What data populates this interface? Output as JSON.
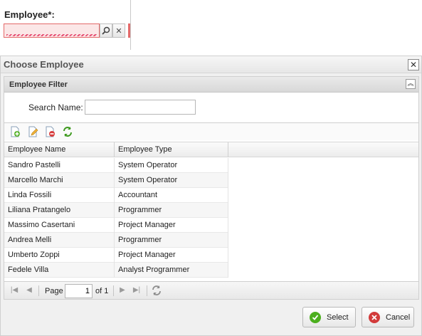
{
  "form": {
    "employee_label": "Employee*:",
    "employee_value": ""
  },
  "dialog": {
    "title": "Choose Employee",
    "filter": {
      "title": "Employee Filter",
      "search_label": "Search Name:",
      "search_value": ""
    },
    "toolbar": {
      "icons": [
        "add-record-icon",
        "edit-record-icon",
        "delete-record-icon",
        "refresh-icon"
      ]
    },
    "grid": {
      "columns": [
        "Employee Name",
        "Employee Type"
      ],
      "rows": [
        [
          "Sandro Pastelli",
          "System Operator"
        ],
        [
          "Marcello Marchi",
          "System Operator"
        ],
        [
          "Linda Fossili",
          "Accountant"
        ],
        [
          "Liliana Pratangelo",
          "Programmer"
        ],
        [
          "Massimo Casertani",
          "Project Manager"
        ],
        [
          "Andrea Melli",
          "Programmer"
        ],
        [
          "Umberto Zoppi",
          "Project Manager"
        ],
        [
          "Fedele Villa",
          "Analyst Programmer"
        ]
      ]
    },
    "pager": {
      "page_label": "Page",
      "page_value": "1",
      "of_label": "of 1"
    },
    "buttons": {
      "select": "Select",
      "cancel": "Cancel"
    }
  },
  "colors": {
    "invalid_border": "#e46a6a",
    "invalid_bg": "#fbe7e7",
    "select_icon": "#4caf1e",
    "cancel_icon": "#d23a3a"
  }
}
